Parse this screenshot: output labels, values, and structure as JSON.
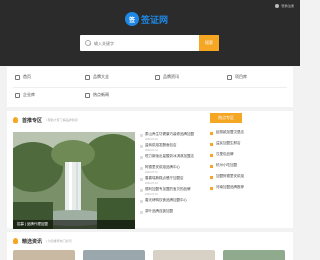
{
  "header": {
    "login_label": "登录|注册",
    "logo_mark": "签",
    "logo_text": "签证网",
    "search_placeholder": "输入关键字",
    "search_button": "搜索"
  },
  "nav": {
    "items": [
      {
        "label": "首页",
        "icon": "home-icon"
      },
      {
        "label": "品牌大全",
        "icon": "tag-icon"
      },
      {
        "label": "品牌资讯",
        "icon": "news-icon"
      },
      {
        "label": "项目库",
        "icon": "folder-icon"
      },
      {
        "label": "企业库",
        "icon": "building-icon"
      },
      {
        "label": "热点新闻",
        "icon": "fire-icon"
      }
    ]
  },
  "featured": {
    "title": "首推专区",
    "subtitle": "| 帮助大家了解品牌新闻",
    "image_caption": "招募 | 品牌代理加盟",
    "middle_items": [
      {
        "text": "泰山养生坊健康巧装修品牌加盟",
        "date": "2020-07-01"
      },
      {
        "text": "盐商烘焙发酵面包店",
        "date": "2020-07-31"
      },
      {
        "text": "恒力新版出量酸奶冰淇淋加盟店",
        "date": ""
      },
      {
        "text": "阿德里安烘焙品牌中心",
        "date": "2020-07-31"
      },
      {
        "text": "春喜瑞典糕点餐厅加盟店",
        "date": "2020-07-31"
      },
      {
        "text": "德利加盟专加盟的宝贝的品牌",
        "date": "2020-07-31"
      },
      {
        "text": "春天烤鸭饮食品牌加盟中心",
        "date": ""
      },
      {
        "text": "茶叶品牌连锁加盟",
        "date": ""
      }
    ],
    "side_head": "热点专区",
    "side_items": [
      "赵丽颖加盟汉堡店",
      "益民加盟生鲜店",
      "汉堡包品牌",
      "杭州小吃加盟",
      "加盟阿德里安烘焙",
      "河南加盟品牌推荐"
    ]
  },
  "select": {
    "title": "精选资讯",
    "subtitle": "| 为您推荐热门资讯"
  }
}
